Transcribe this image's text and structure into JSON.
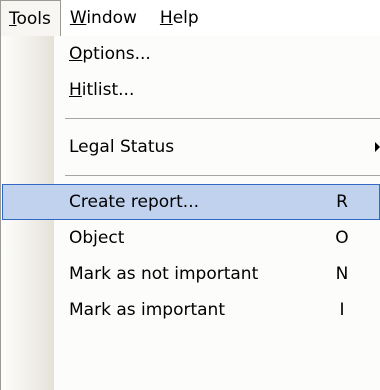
{
  "menubar": {
    "items": [
      {
        "pre": "",
        "key": "T",
        "post": "ools"
      },
      {
        "pre": "",
        "key": "W",
        "post": "indow"
      },
      {
        "pre": "",
        "key": "H",
        "post": "elp"
      }
    ]
  },
  "dropdown": {
    "items": [
      {
        "pre": "",
        "key": "O",
        "post": "ptions..."
      },
      {
        "pre": "",
        "key": "H",
        "post": "itlist..."
      },
      {
        "label": "Legal Status"
      },
      {
        "label": "Create report...",
        "shortcut": "R"
      },
      {
        "label": "Object",
        "shortcut": "O"
      },
      {
        "label": "Mark as not important",
        "shortcut": "N"
      },
      {
        "label": "Mark as important",
        "shortcut": "I"
      }
    ]
  },
  "colors": {
    "highlight_fill": "#c1d2ee",
    "highlight_border": "#316ac5",
    "separator": "#a6a6a6"
  },
  "icons": {
    "submenu": "submenu-arrow-icon"
  }
}
